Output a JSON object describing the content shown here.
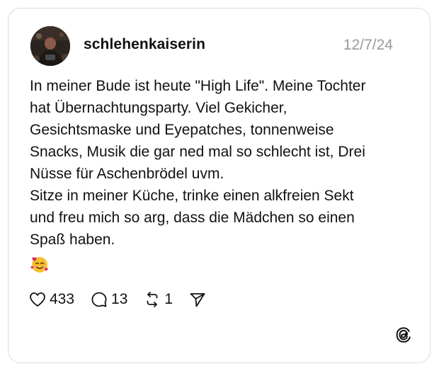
{
  "post": {
    "username": "schlehenkaiserin",
    "date": "12/7/24",
    "text_lines": [
      "In meiner Bude ist heute \"High Life\". Meine Tochter",
      "hat Übernachtungsparty. Viel Gekicher,",
      "Gesichtsmaske und Eyepatches, tonnenweise",
      "Snacks, Musik die gar ned mal so schlecht ist, Drei",
      "Nüsse für Aschenbrödel uvm.",
      "Sitze in meiner Küche, trinke einen alkfreien Sekt",
      "und freu mich so arg, dass die Mädchen so einen",
      "Spaß haben."
    ],
    "emoji": "smiling-face-with-hearts"
  },
  "actions": {
    "likes": "433",
    "replies": "13",
    "reposts": "1"
  },
  "icons": {
    "like": "heart-icon",
    "reply": "comment-bubble-icon",
    "repost": "repost-icon",
    "share": "send-icon",
    "brand": "threads-logo-icon"
  },
  "colors": {
    "text": "#111111",
    "muted": "#9a9a9a",
    "border": "#dcdcdc"
  }
}
